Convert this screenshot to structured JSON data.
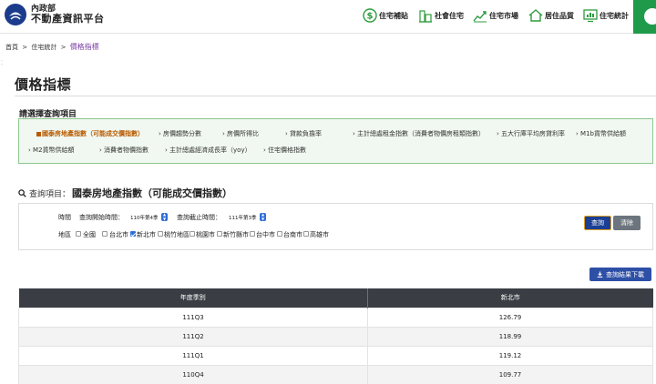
{
  "header": {
    "org": "內政部",
    "site": "不動產資訊平台",
    "nav": [
      {
        "label": "住宅補貼",
        "icon": "dollar-icon"
      },
      {
        "label": "社會住宅",
        "icon": "buildings-icon"
      },
      {
        "label": "住宅市場",
        "icon": "trend-chart-icon"
      },
      {
        "label": "居住品質",
        "icon": "house-icon"
      },
      {
        "label": "住宅統計",
        "icon": "monitor-chart-icon"
      }
    ],
    "colors": {
      "accent": "#1f9a4a",
      "nav_icon": "#2e9b3e"
    }
  },
  "breadcrumb": {
    "home": "首頁",
    "parent": "住宅統計",
    "current": "價格指標",
    "sep": ">"
  },
  "page": {
    "title": "價格指標",
    "section_label": "請選擇查詢項目"
  },
  "options": [
    "國泰房地產指數（可能成交價指數）",
    "房價趨勢分數",
    "房價所得比",
    "貸款負擔率",
    "主計總處租金指數（消費者物價房租類指數）",
    "五大行庫平均房貸利率",
    "M1b貨幣供給額",
    "M2貨幣供給額",
    "消費者物價指數",
    "主計總處經濟成長率（yoy）",
    "住宅價格指數"
  ],
  "query": {
    "label": "查詢項目：",
    "value": "國泰房地產指數（可能成交價指數）"
  },
  "filters": {
    "time_label": "時間",
    "start_label": "查詢開始時間：",
    "start_value": "110年第4季",
    "end_label": "查詢截止時間：",
    "end_value": "111年第3季",
    "region_label": "地區",
    "regions": [
      {
        "label": "全國",
        "checked": false
      },
      {
        "label": "台北市",
        "checked": false
      },
      {
        "label": "新北市",
        "checked": true
      },
      {
        "label": "桃竹地區",
        "checked": false
      },
      {
        "label": "桃園市",
        "checked": false
      },
      {
        "label": "新竹縣市",
        "checked": false
      },
      {
        "label": "台中市",
        "checked": false
      },
      {
        "label": "台南市",
        "checked": false
      },
      {
        "label": "高雄市",
        "checked": false
      }
    ]
  },
  "buttons": {
    "query": "查詢",
    "clear": "清除",
    "download": "查詢結果下載"
  },
  "table": {
    "headers": [
      "年度季別",
      "新北市"
    ],
    "rows": [
      [
        "111Q3",
        "126.79"
      ],
      [
        "111Q2",
        "118.99"
      ],
      [
        "111Q1",
        "119.12"
      ],
      [
        "110Q4",
        "109.77"
      ]
    ]
  }
}
